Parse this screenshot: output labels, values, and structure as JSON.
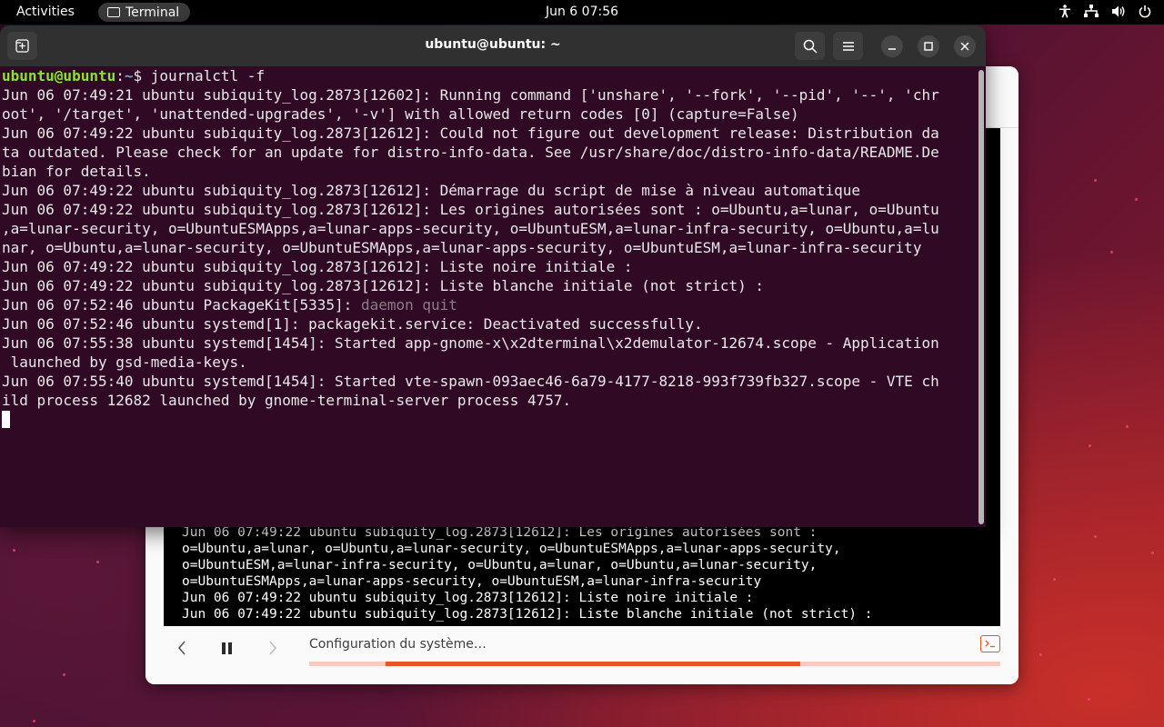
{
  "topbar": {
    "activities": "Activities",
    "app_name": "Terminal",
    "clock": "Jun 6  07:56"
  },
  "terminal": {
    "title": "ubuntu@ubuntu: ~",
    "prompt_user": "ubuntu@ubuntu",
    "prompt_sep": ":",
    "prompt_path": "~",
    "prompt_symbol": "$ ",
    "command": "journalctl -f",
    "lines": [
      "Jun 06 07:49:21 ubuntu subiquity_log.2873[12602]: Running command ['unshare', '--fork', '--pid', '--', 'chr",
      "oot', '/target', 'unattended-upgrades', '-v'] with allowed return codes [0] (capture=False)",
      "Jun 06 07:49:22 ubuntu subiquity_log.2873[12612]: Could not figure out development release: Distribution da",
      "ta outdated. Please check for an update for distro-info-data. See /usr/share/doc/distro-info-data/README.De",
      "bian for details.",
      "Jun 06 07:49:22 ubuntu subiquity_log.2873[12612]: Démarrage du script de mise à niveau automatique",
      "Jun 06 07:49:22 ubuntu subiquity_log.2873[12612]: Les origines autorisées sont : o=Ubuntu,a=lunar, o=Ubuntu",
      ",a=lunar-security, o=UbuntuESMApps,a=lunar-apps-security, o=UbuntuESM,a=lunar-infra-security, o=Ubuntu,a=lu",
      "nar, o=Ubuntu,a=lunar-security, o=UbuntuESMApps,a=lunar-apps-security, o=UbuntuESM,a=lunar-infra-security",
      "Jun 06 07:49:22 ubuntu subiquity_log.2873[12612]: Liste noire initiale :",
      "Jun 06 07:49:22 ubuntu subiquity_log.2873[12612]: Liste blanche initiale (not strict) :"
    ],
    "packagekit_prefix": "Jun 06 07:52:46 ubuntu PackageKit[5335]: ",
    "packagekit_msg": "daemon quit",
    "lines_after": [
      "Jun 06 07:52:46 ubuntu systemd[1]: packagekit.service: Deactivated successfully.",
      "Jun 06 07:55:38 ubuntu systemd[1454]: Started app-gnome-x\\x2dterminal\\x2demulator-12674.scope - Application",
      " launched by gsd-media-keys.",
      "Jun 06 07:55:40 ubuntu systemd[1454]: Started vte-spawn-093aec46-6a79-4177-8218-993f739fb327.scope - VTE ch",
      "ild process 12682 launched by gnome-terminal-server process 4757."
    ]
  },
  "installer": {
    "log_lines": [
      "Jun 06 07:49:22 ubuntu subiquity_log.2873[12612]: Les origines autorisées sont :",
      "o=Ubuntu,a=lunar, o=Ubuntu,a=lunar-security, o=UbuntuESMApps,a=lunar-apps-security,",
      "o=UbuntuESM,a=lunar-infra-security, o=Ubuntu,a=lunar, o=Ubuntu,a=lunar-security,",
      "o=UbuntuESMApps,a=lunar-apps-security, o=UbuntuESM,a=lunar-infra-security",
      "Jun 06 07:49:22 ubuntu subiquity_log.2873[12612]: Liste noire initiale :",
      "Jun 06 07:49:22 ubuntu subiquity_log.2873[12612]: Liste blanche initiale (not strict) :"
    ],
    "status": "Configuration du système…",
    "progress_start": 0.11,
    "progress_end": 0.71
  },
  "colors": {
    "terminal_bg": "#300a24",
    "accent": "#e95420",
    "prompt_user": "#8ae234",
    "prompt_path": "#729fcf"
  }
}
